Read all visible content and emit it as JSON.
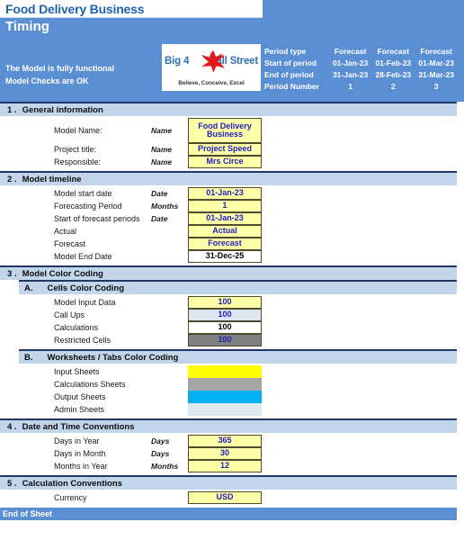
{
  "workbook": {
    "model_title": "Food Delivery Business",
    "sheet_name": "Timing",
    "status_1": "The Model is fully functional",
    "status_2": "Model Checks are OK",
    "end_of_sheet": "End of Sheet"
  },
  "logo": {
    "text_left": "Big 4",
    "text_right": "Wall Street",
    "tagline": "Believe, Conceive, Excel",
    "bird_icon": "eagle-icon",
    "bird_color": "#e4151b",
    "text_color": "#2f6fb5"
  },
  "period_table": {
    "rows": [
      {
        "label": "Period type",
        "values": [
          "Forecast",
          "Forecast",
          "Forecast"
        ]
      },
      {
        "label": "Start of period",
        "values": [
          "01-Jan-23",
          "01-Feb-23",
          "01-Mar-23"
        ]
      },
      {
        "label": "End of period",
        "values": [
          "31-Jan-23",
          "28-Feb-23",
          "31-Mar-23"
        ]
      },
      {
        "label": "Period Number",
        "values": [
          "1",
          "2",
          "3"
        ]
      }
    ]
  },
  "sections": [
    {
      "number": "1 .",
      "title": "General information",
      "rows": [
        {
          "label": "Model Name:",
          "unit": "Name",
          "value": "Food Delivery Business",
          "style": "input",
          "tall": true
        },
        {
          "label": "Project title:",
          "unit": "Name",
          "value": "Project Speed",
          "style": "input"
        },
        {
          "label": "Responsible:",
          "unit": "Name",
          "value": "Mrs Circe",
          "style": "input"
        }
      ]
    },
    {
      "number": "2 .",
      "title": "Model timeline",
      "rows": [
        {
          "label": "Model start date",
          "unit": "Date",
          "value": "01-Jan-23",
          "style": "input"
        },
        {
          "label": "Forecasting Period",
          "unit": "Months",
          "value": "1",
          "style": "input"
        },
        {
          "label": "Start of forecast periods",
          "unit": "Date",
          "value": "01-Jan-23",
          "style": "input"
        },
        {
          "label": "Actual",
          "unit": "",
          "value": "Actual",
          "style": "input"
        },
        {
          "label": "Forecast",
          "unit": "",
          "value": "Forecast",
          "style": "input"
        },
        {
          "label": "Model End Date",
          "unit": "",
          "value": "31-Dec-25",
          "style": "calc"
        }
      ]
    },
    {
      "number": "3 .",
      "title": "Model Color Coding",
      "subsections": [
        {
          "number": "A.",
          "title": "Cells Color Coding",
          "rows": [
            {
              "label": "Model Input Data",
              "unit": "",
              "value": "100",
              "style": "input",
              "color": "#ffffa8"
            },
            {
              "label": "Call Ups",
              "unit": "",
              "value": "100",
              "style": "callup",
              "color": "#dce6f1"
            },
            {
              "label": "Calculations",
              "unit": "",
              "value": "100",
              "style": "calc",
              "color": "#ffffff"
            },
            {
              "label": "Restricted Cells",
              "unit": "",
              "value": "100",
              "style": "restricted",
              "color": "#808080"
            }
          ]
        },
        {
          "number": "B.",
          "title": "Worksheets / Tabs Color Coding",
          "rows": [
            {
              "label": "Input Sheets",
              "unit": "",
              "value": "",
              "style": "swatch",
              "color": "#ffff00"
            },
            {
              "label": "Calculations Sheets",
              "unit": "",
              "value": "",
              "style": "swatch",
              "color": "#a6a6a6"
            },
            {
              "label": "Output Sheets",
              "unit": "",
              "value": "",
              "style": "swatch",
              "color": "#00b0f0"
            },
            {
              "label": "Admin Sheets",
              "unit": "",
              "value": "",
              "style": "swatch",
              "color": "#dce9ee"
            }
          ]
        }
      ]
    },
    {
      "number": "4 .",
      "title": "Date and Time Conventions",
      "rows": [
        {
          "label": "Days in Year",
          "unit": "Days",
          "value": "365",
          "style": "input"
        },
        {
          "label": "Days in Month",
          "unit": "Days",
          "value": "30",
          "style": "input"
        },
        {
          "label": "Months in Year",
          "unit": "Months",
          "value": "12",
          "style": "input"
        }
      ]
    },
    {
      "number": "5 .",
      "title": "Calculation Conventions",
      "rows": [
        {
          "label": "Currency",
          "unit": "",
          "value": "USD",
          "style": "input"
        }
      ]
    }
  ],
  "theme": {
    "banner_blue": "#5b8fd4",
    "section_bar_blue": "#c3d5ea",
    "section_border_navy": "#1f3864",
    "input_yellow": "#ffffa8",
    "value_text_blue": "#2020c0",
    "title_text_blue": "#1f63b0"
  }
}
